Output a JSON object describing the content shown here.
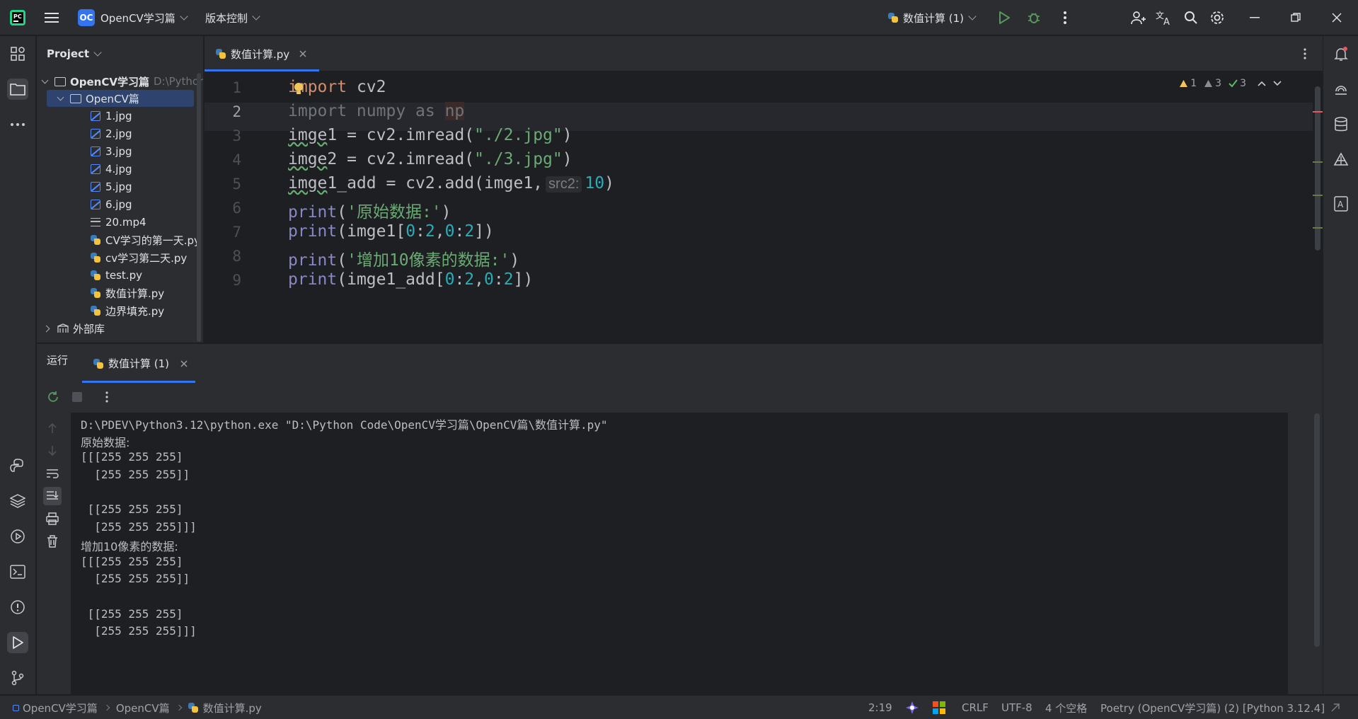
{
  "titlebar": {
    "project_badge": "OC",
    "project_name": "OpenCV学习篇",
    "vcs_label": "版本控制",
    "run_config": "数值计算 (1)"
  },
  "project_panel": {
    "title": "Project",
    "root_name": "OpenCV学习篇",
    "root_path": "D:\\Pythor",
    "folder_name": "OpenCV篇",
    "files": [
      {
        "name": "1.jpg",
        "type": "image"
      },
      {
        "name": "2.jpg",
        "type": "image"
      },
      {
        "name": "3.jpg",
        "type": "image"
      },
      {
        "name": "4.jpg",
        "type": "image"
      },
      {
        "name": "5.jpg",
        "type": "image"
      },
      {
        "name": "6.jpg",
        "type": "image"
      },
      {
        "name": "20.mp4",
        "type": "text"
      },
      {
        "name": "CV学习的第一天.py",
        "type": "python"
      },
      {
        "name": "cv学习第二天.py",
        "type": "python"
      },
      {
        "name": "test.py",
        "type": "python"
      },
      {
        "name": "数值计算.py",
        "type": "python"
      },
      {
        "name": "边界填充.py",
        "type": "python"
      }
    ],
    "external_libs": "外部库"
  },
  "editor": {
    "tab_label": "数值计算.py",
    "inspections": {
      "warnings": "1",
      "weak_warnings": "3",
      "ok": "3"
    },
    "line_numbers": [
      "1",
      "2",
      "3",
      "4",
      "5",
      "6",
      "7",
      "8",
      "9"
    ],
    "param_hint": "src2:"
  },
  "run_panel": {
    "title": "运行",
    "tab_label": "数值计算 (1)",
    "console_lines": [
      "D:\\PDEV\\Python3.12\\python.exe \"D:\\Python Code\\OpenCV学习篇\\OpenCV篇\\数值计算.py\"",
      "原始数据:",
      "[[[255 255 255]",
      "  [255 255 255]]",
      "",
      " [[255 255 255]",
      "  [255 255 255]]]",
      "增加10像素的数据:",
      "[[[255 255 255]",
      "  [255 255 255]]",
      "",
      " [[255 255 255]",
      "  [255 255 255]]]"
    ]
  },
  "statusbar": {
    "crumb_project": "OpenCV学习篇",
    "crumb_folder": "OpenCV篇",
    "crumb_file": "数值计算.py",
    "position": "2:19",
    "line_separator": "CRLF",
    "encoding": "UTF-8",
    "indent": "4 个空格",
    "interpreter": "Poetry (OpenCV学习篇) (2) [Python 3.12.4]"
  },
  "colors": {
    "accent": "#3574f0",
    "keyword": "#cf8e6d",
    "string": "#6aab73",
    "number": "#2aacb8",
    "builtin": "#8888c6"
  }
}
